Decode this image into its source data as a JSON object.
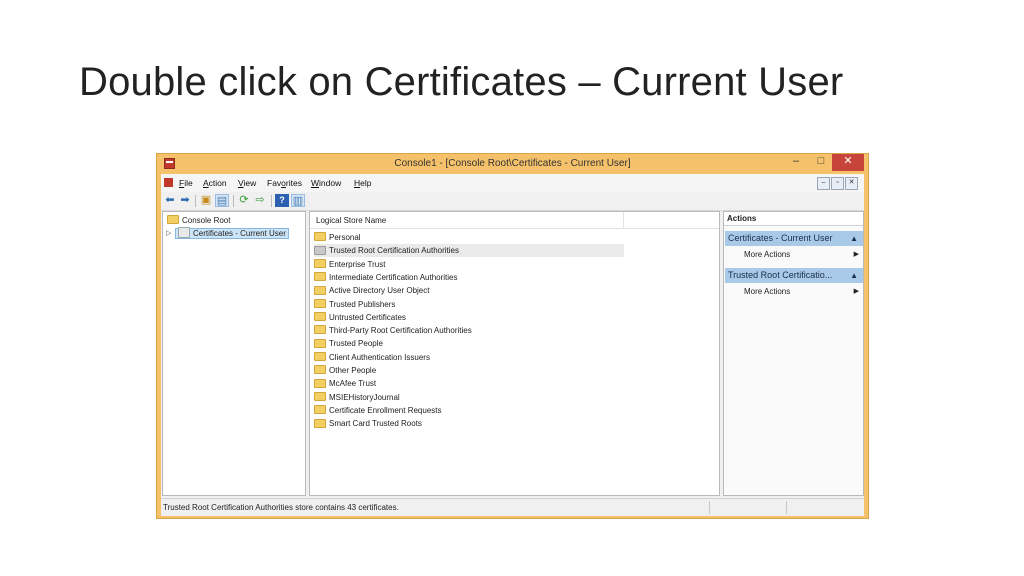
{
  "slide": {
    "title": "Double click on Certificates – Current User"
  },
  "window": {
    "title": "Console1 - [Console Root\\Certificates - Current User]",
    "controls": {
      "minimize": "–",
      "maximize": "□",
      "close": "✕"
    }
  },
  "menu": {
    "items": [
      {
        "accel": "F",
        "rest": "ile"
      },
      {
        "accel": "A",
        "rest": "ction"
      },
      {
        "accel": "V",
        "rest": "iew"
      },
      {
        "pre": "Fav",
        "accel": "o",
        "rest": "rites"
      },
      {
        "accel": "W",
        "rest": "indow"
      },
      {
        "accel": "H",
        "rest": "elp"
      }
    ],
    "mdi": {
      "minimize": "–",
      "restore": "▫",
      "close": "✕"
    }
  },
  "tree": {
    "root": "Console Root",
    "child": "Certificates - Current User",
    "expander": "▷"
  },
  "list": {
    "column": "Logical Store Name",
    "items": [
      "Personal",
      "Trusted Root Certification Authorities",
      "Enterprise Trust",
      "Intermediate Certification Authorities",
      "Active Directory User Object",
      "Trusted Publishers",
      "Untrusted Certificates",
      "Third-Party Root Certification Authorities",
      "Trusted People",
      "Client Authentication Issuers",
      "Other People",
      "McAfee Trust",
      "MSIEHistoryJournal",
      "Certificate Enrollment Requests",
      "Smart Card Trusted Roots"
    ],
    "highlighted_index": 1
  },
  "actions": {
    "header": "Actions",
    "groups": [
      {
        "title": "Certificates - Current User",
        "item": "More Actions"
      },
      {
        "title": "Trusted Root Certificatio...",
        "item": "More Actions"
      }
    ]
  },
  "status": {
    "text": "Trusted Root Certification Authorities store contains 43 certificates."
  },
  "colors": {
    "frame": "#f5c26b",
    "close": "#c7443a",
    "action_group": "#a8c9e8",
    "folder": "#f2cf62"
  }
}
